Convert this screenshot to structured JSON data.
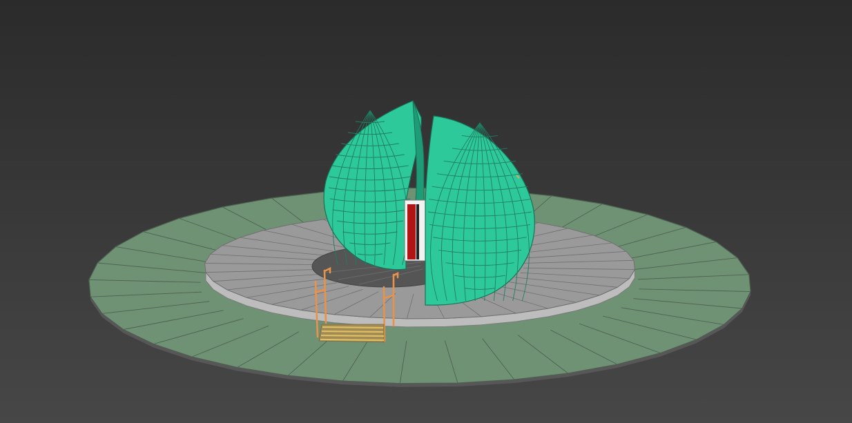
{
  "viewport": {
    "background_top": "#2b2b2b",
    "background_bottom": "#474747"
  },
  "scene": {
    "ground_ring": {
      "color": "#6f9275",
      "edge_color": "#4c6150",
      "segments": 36
    },
    "plaza_ring": {
      "color": "#9a9a9a",
      "edge_color": "#6f6f6f",
      "segments": 36
    },
    "inner_floor": {
      "color": "#555555"
    },
    "dome": {
      "color": "#2ec99a",
      "wire_color": "#1f7d61",
      "halves": 2
    },
    "doorway": {
      "frame_color": "#f2f2f2",
      "panel_color": "#b01414"
    },
    "stair_railings": {
      "color": "#e8924a"
    },
    "steps": {
      "color": "#d6b35a"
    }
  }
}
